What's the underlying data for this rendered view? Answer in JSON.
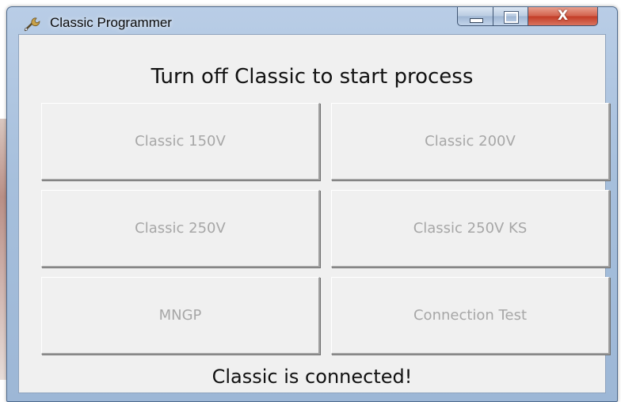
{
  "window": {
    "title": "Classic Programmer",
    "icon": "wrench-app-icon",
    "caption_controls": [
      "minimize",
      "maximize",
      "close"
    ],
    "close_glyph": "X"
  },
  "main": {
    "heading": "Turn off Classic to start process",
    "buttons": [
      {
        "label": "Classic 150V",
        "enabled": false
      },
      {
        "label": "Classic 200V",
        "enabled": false
      },
      {
        "label": "Classic 250V",
        "enabled": false
      },
      {
        "label": "Classic 250V KS",
        "enabled": false
      },
      {
        "label": "MNGP",
        "enabled": false
      },
      {
        "label": "Connection Test",
        "enabled": false
      }
    ],
    "status": "Classic is connected!"
  },
  "colors": {
    "client_bg": "#f0f0f0",
    "disabled_text": "#a7a7a7",
    "close_button": "#c23b25",
    "titlebar": "#a6bfdc"
  }
}
